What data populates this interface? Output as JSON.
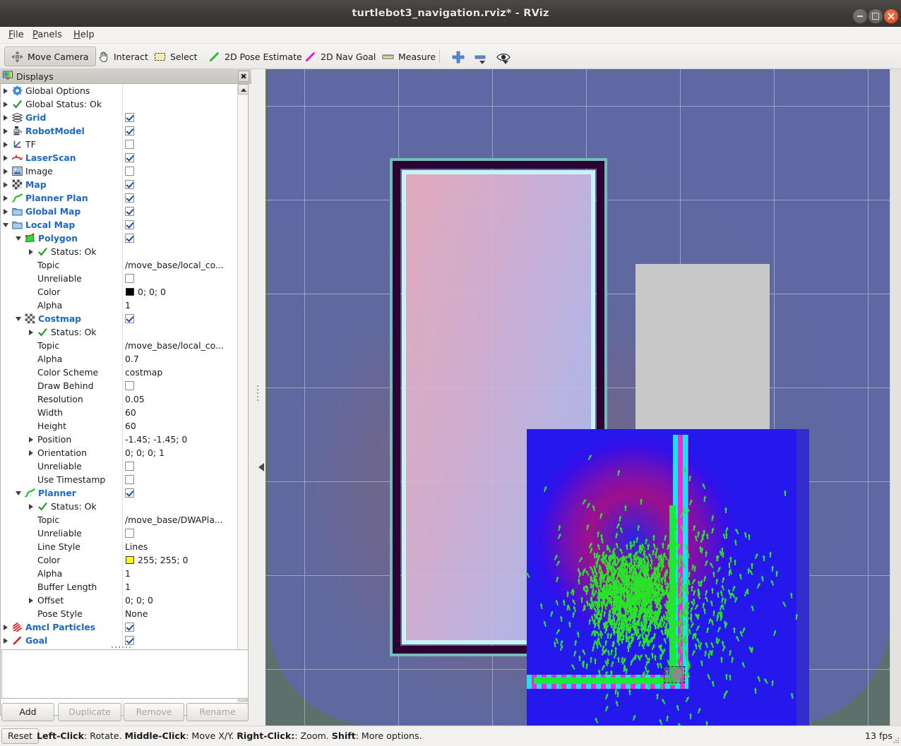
{
  "window": {
    "title": "turtlebot3_navigation.rviz* - RViz",
    "buttons": {
      "minimize": "minimize",
      "maximize": "maximize",
      "close": "close"
    }
  },
  "menubar": {
    "items": [
      {
        "label": "File",
        "mnemonic": "F"
      },
      {
        "label": "Panels",
        "mnemonic": "P"
      },
      {
        "label": "Help",
        "mnemonic": "H"
      }
    ]
  },
  "toolbar": {
    "tools": [
      {
        "label": "Move Camera",
        "icon": "move-camera-icon",
        "checked": true
      },
      {
        "label": "Interact",
        "icon": "hand-pointer-icon",
        "checked": false
      },
      {
        "label": "Select",
        "icon": "selection-rect-icon",
        "checked": false
      },
      {
        "label": "2D Pose Estimate",
        "icon": "green-arrow-icon",
        "checked": false
      },
      {
        "label": "2D Nav Goal",
        "icon": "magenta-arrow-icon",
        "checked": false
      },
      {
        "label": "Measure",
        "icon": "ruler-icon",
        "checked": false
      }
    ],
    "extras": [
      {
        "icon": "plus-icon",
        "label": "Add tool"
      },
      {
        "icon": "minus-icon",
        "label": "Remove tool"
      },
      {
        "icon": "eye-icon",
        "label": "View settings"
      }
    ]
  },
  "displays_panel": {
    "title": "Displays",
    "close_label": "✖",
    "tree": [
      {
        "indent": 0,
        "arrow": "closed",
        "icon": "gear-icon",
        "label": "Global Options",
        "style": "plain",
        "value": null,
        "check": null
      },
      {
        "indent": 0,
        "arrow": "closed",
        "icon": "check-icon",
        "label": "Global Status: Ok",
        "style": "plain",
        "value": null,
        "check": null
      },
      {
        "indent": 0,
        "arrow": "closed",
        "icon": "grid-icon",
        "label": "Grid",
        "style": "bold",
        "value": null,
        "check": true
      },
      {
        "indent": 0,
        "arrow": "closed",
        "icon": "robot-icon",
        "label": "RobotModel",
        "style": "bold",
        "value": null,
        "check": true
      },
      {
        "indent": 0,
        "arrow": "closed",
        "icon": "tf-axes-icon",
        "label": "TF",
        "style": "plain",
        "value": null,
        "check": false
      },
      {
        "indent": 0,
        "arrow": "closed",
        "icon": "laserscan-icon",
        "label": "LaserScan",
        "style": "bold",
        "value": null,
        "check": true
      },
      {
        "indent": 0,
        "arrow": "closed",
        "icon": "image-icon",
        "label": "Image",
        "style": "plain",
        "value": null,
        "check": false
      },
      {
        "indent": 0,
        "arrow": "closed",
        "icon": "map-icon",
        "label": "Map",
        "style": "bold",
        "value": null,
        "check": true
      },
      {
        "indent": 0,
        "arrow": "closed",
        "icon": "path-icon",
        "label": "Planner Plan",
        "style": "bold",
        "value": null,
        "check": true
      },
      {
        "indent": 0,
        "arrow": "closed",
        "icon": "folder-icon",
        "label": "Global Map",
        "style": "bold",
        "value": null,
        "check": true
      },
      {
        "indent": 0,
        "arrow": "open",
        "icon": "folder-icon",
        "label": "Local Map",
        "style": "bold",
        "value": null,
        "check": true
      },
      {
        "indent": 1,
        "arrow": "open",
        "icon": "polygon-icon",
        "label": "Polygon",
        "style": "bold",
        "value": null,
        "check": true
      },
      {
        "indent": 2,
        "arrow": "closed",
        "icon": "check-icon",
        "label": "Status: Ok",
        "style": "plain",
        "value": null,
        "check": null
      },
      {
        "indent": 2,
        "arrow": "none",
        "icon": null,
        "label": "Topic",
        "style": "plain",
        "value": "/move_base/local_co...",
        "check": null
      },
      {
        "indent": 2,
        "arrow": "none",
        "icon": null,
        "label": "Unreliable",
        "style": "plain",
        "value": null,
        "check": false
      },
      {
        "indent": 2,
        "arrow": "none",
        "icon": null,
        "label": "Color",
        "style": "plain",
        "value": "0; 0; 0",
        "check": null,
        "swatch": "#000000"
      },
      {
        "indent": 2,
        "arrow": "none",
        "icon": null,
        "label": "Alpha",
        "style": "plain",
        "value": "1",
        "check": null
      },
      {
        "indent": 1,
        "arrow": "open",
        "icon": "costmap-icon",
        "label": "Costmap",
        "style": "bold",
        "value": null,
        "check": true
      },
      {
        "indent": 2,
        "arrow": "closed",
        "icon": "check-icon",
        "label": "Status: Ok",
        "style": "plain",
        "value": null,
        "check": null
      },
      {
        "indent": 2,
        "arrow": "none",
        "icon": null,
        "label": "Topic",
        "style": "plain",
        "value": "/move_base/local_co...",
        "check": null
      },
      {
        "indent": 2,
        "arrow": "none",
        "icon": null,
        "label": "Alpha",
        "style": "plain",
        "value": "0.7",
        "check": null
      },
      {
        "indent": 2,
        "arrow": "none",
        "icon": null,
        "label": "Color Scheme",
        "style": "plain",
        "value": "costmap",
        "check": null
      },
      {
        "indent": 2,
        "arrow": "none",
        "icon": null,
        "label": "Draw Behind",
        "style": "plain",
        "value": null,
        "check": false
      },
      {
        "indent": 2,
        "arrow": "none",
        "icon": null,
        "label": "Resolution",
        "style": "plain",
        "value": "0.05",
        "check": null
      },
      {
        "indent": 2,
        "arrow": "none",
        "icon": null,
        "label": "Width",
        "style": "plain",
        "value": "60",
        "check": null
      },
      {
        "indent": 2,
        "arrow": "none",
        "icon": null,
        "label": "Height",
        "style": "plain",
        "value": "60",
        "check": null
      },
      {
        "indent": 2,
        "arrow": "closed",
        "icon": null,
        "label": "Position",
        "style": "plain",
        "value": "-1.45; -1.45; 0",
        "check": null
      },
      {
        "indent": 2,
        "arrow": "closed",
        "icon": null,
        "label": "Orientation",
        "style": "plain",
        "value": "0; 0; 0; 1",
        "check": null
      },
      {
        "indent": 2,
        "arrow": "none",
        "icon": null,
        "label": "Unreliable",
        "style": "plain",
        "value": null,
        "check": false
      },
      {
        "indent": 2,
        "arrow": "none",
        "icon": null,
        "label": "Use Timestamp",
        "style": "plain",
        "value": null,
        "check": false
      },
      {
        "indent": 1,
        "arrow": "open",
        "icon": "path-icon",
        "label": "Planner",
        "style": "bold",
        "value": null,
        "check": true
      },
      {
        "indent": 2,
        "arrow": "closed",
        "icon": "check-icon",
        "label": "Status: Ok",
        "style": "plain",
        "value": null,
        "check": null
      },
      {
        "indent": 2,
        "arrow": "none",
        "icon": null,
        "label": "Topic",
        "style": "plain",
        "value": "/move_base/DWAPla...",
        "check": null
      },
      {
        "indent": 2,
        "arrow": "none",
        "icon": null,
        "label": "Unreliable",
        "style": "plain",
        "value": null,
        "check": false
      },
      {
        "indent": 2,
        "arrow": "none",
        "icon": null,
        "label": "Line Style",
        "style": "plain",
        "value": "Lines",
        "check": null
      },
      {
        "indent": 2,
        "arrow": "none",
        "icon": null,
        "label": "Color",
        "style": "plain",
        "value": "255; 255; 0",
        "check": null,
        "swatch": "#ffff00"
      },
      {
        "indent": 2,
        "arrow": "none",
        "icon": null,
        "label": "Alpha",
        "style": "plain",
        "value": "1",
        "check": null
      },
      {
        "indent": 2,
        "arrow": "none",
        "icon": null,
        "label": "Buffer Length",
        "style": "plain",
        "value": "1",
        "check": null
      },
      {
        "indent": 2,
        "arrow": "closed",
        "icon": null,
        "label": "Offset",
        "style": "plain",
        "value": "0; 0; 0",
        "check": null
      },
      {
        "indent": 2,
        "arrow": "none",
        "icon": null,
        "label": "Pose Style",
        "style": "plain",
        "value": "None",
        "check": null
      },
      {
        "indent": 0,
        "arrow": "closed",
        "icon": "particles-icon",
        "label": "Amcl Particles",
        "style": "bold",
        "value": null,
        "check": true
      },
      {
        "indent": 0,
        "arrow": "closed",
        "icon": "goal-arrow-icon",
        "label": "Goal",
        "style": "bold",
        "value": null,
        "check": true
      }
    ],
    "buttons": [
      {
        "label": "Add",
        "enabled": true
      },
      {
        "label": "Duplicate",
        "enabled": false
      },
      {
        "label": "Remove",
        "enabled": false
      },
      {
        "label": "Rename",
        "enabled": false
      }
    ]
  },
  "viewport": {
    "name": "3d-render-view",
    "colors": {
      "background": "#5e706c",
      "grid_line": "#cfd6d4",
      "global_inflation": "#6067a8",
      "wall_occupied": "#2a0130",
      "wall_highlight": "#72bcbc",
      "free_space": "#d8b4d7",
      "unknown": "#c8c8c8",
      "costmap_lethal_cyan": "#16e6f0",
      "costmap_lethal_magenta": "#ef2ad6",
      "costmap_inscribed": "#17ea3a",
      "costmap_low": "#2a22e6",
      "particle_arrow": "#2ae22a",
      "robot_body": "#8a8a8a"
    }
  },
  "statusbar": {
    "reset_label": "Reset",
    "hint_parts": [
      {
        "text": "Left-Click",
        "bold": true
      },
      {
        "text": ": Rotate.  ",
        "bold": false
      },
      {
        "text": "Middle-Click",
        "bold": true
      },
      {
        "text": ": Move X/Y.  ",
        "bold": false
      },
      {
        "text": "Right-Click:",
        "bold": true
      },
      {
        "text": ": Zoom.  ",
        "bold": false
      },
      {
        "text": "Shift",
        "bold": true
      },
      {
        "text": ": More options.",
        "bold": false
      }
    ],
    "fps": "13 fps"
  }
}
